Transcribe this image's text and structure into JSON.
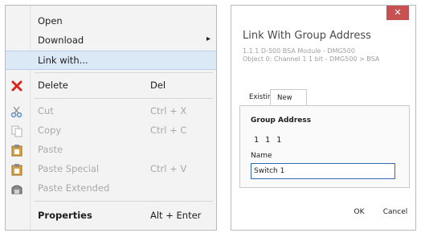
{
  "context_menu": {
    "items": [
      {
        "label": "Open",
        "shortcut": "",
        "state": "normal",
        "icon": ""
      },
      {
        "label": "Download",
        "shortcut": "",
        "state": "normal",
        "icon": "",
        "submenu": true
      },
      {
        "label": "Link with...",
        "shortcut": "",
        "state": "hover",
        "icon": ""
      },
      {
        "label": "Delete",
        "shortcut": "Del",
        "state": "normal",
        "icon": "delete-icon"
      },
      {
        "label": "Cut",
        "shortcut": "Ctrl + X",
        "state": "disabled",
        "icon": "cut-icon"
      },
      {
        "label": "Copy",
        "shortcut": "Ctrl + C",
        "state": "disabled",
        "icon": "copy-icon"
      },
      {
        "label": "Paste",
        "shortcut": "",
        "state": "disabled",
        "icon": "paste-icon"
      },
      {
        "label": "Paste Special",
        "shortcut": "Ctrl + V",
        "state": "disabled",
        "icon": "paste-special-icon"
      },
      {
        "label": "Paste Extended",
        "shortcut": "",
        "state": "disabled",
        "icon": "paste-extended-icon"
      },
      {
        "label": "Properties",
        "shortcut": "Alt + Enter",
        "state": "bold",
        "icon": ""
      }
    ],
    "submenu_arrow": "▸"
  },
  "dialog": {
    "close_glyph": "✕",
    "title": "Link With Group Address",
    "subtitle_line1": "1.1.1 D-500 BSA Module - DMG500",
    "subtitle_line2": "Object 0: Channel 1 1 bit - DMG500 > BSA",
    "tabs": [
      "Existing",
      "New"
    ],
    "active_tab": "New",
    "group_address_label": "Group Address",
    "group_address_value": "1 1 1",
    "name_label": "Name",
    "name_value": "Switch 1",
    "ok_label": "OK",
    "cancel_label": "Cancel"
  },
  "colors": {
    "menu_bg": "#f3f3f3",
    "hover_bg": "#dbe8f6",
    "delete_red": "#d6261d",
    "close_red": "#c75050",
    "input_border": "#2f6bb5"
  }
}
